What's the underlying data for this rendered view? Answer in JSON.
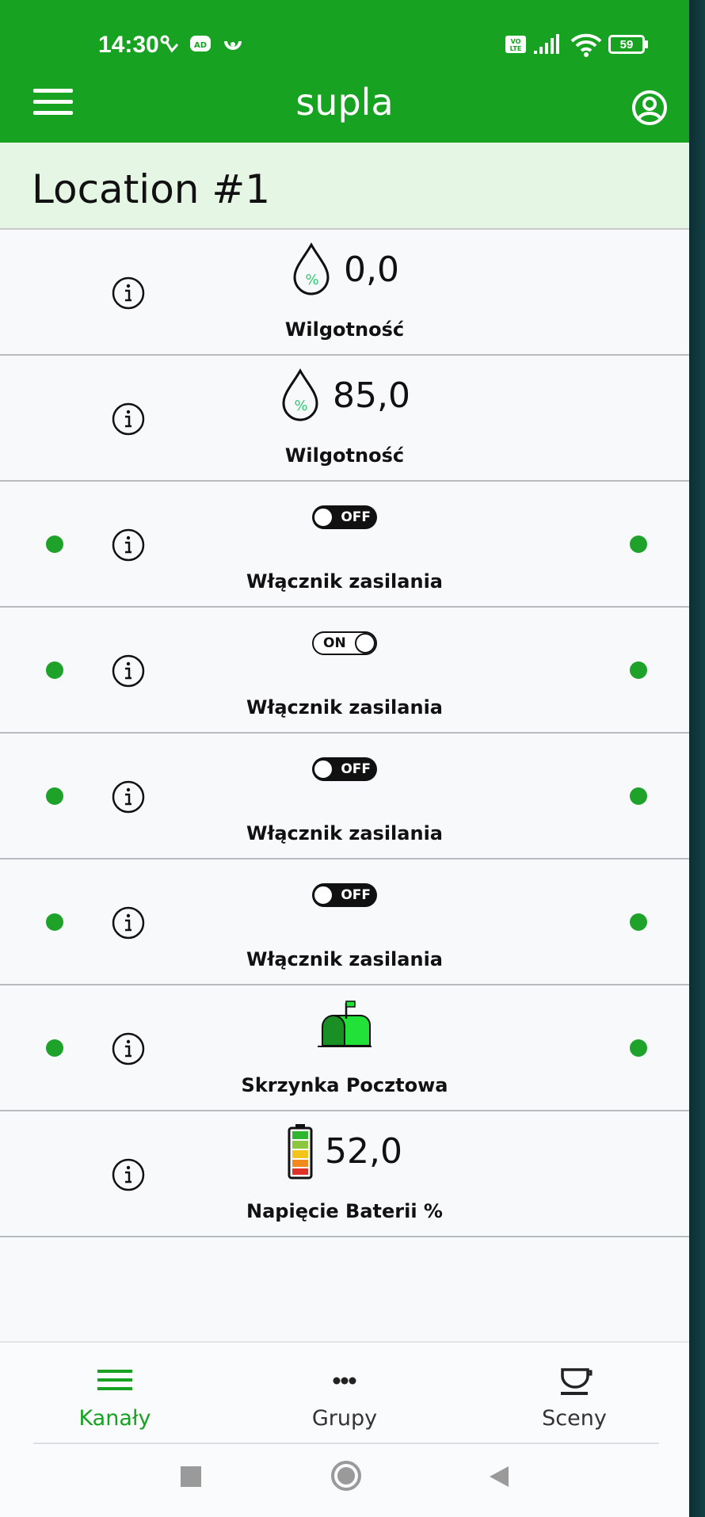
{
  "status_bar": {
    "time": "14:30",
    "battery": "59"
  },
  "app_bar": {
    "title": "supla"
  },
  "location": {
    "label": "Location #1"
  },
  "channels": [
    {
      "type": "humidity",
      "value": "0,0",
      "caption": "Wilgotność",
      "status": false
    },
    {
      "type": "humidity",
      "value": "85,0",
      "caption": "Wilgotność",
      "status": false
    },
    {
      "type": "switch",
      "state": "OFF",
      "caption": "Włącznik zasilania",
      "status": true
    },
    {
      "type": "switch",
      "state": "ON",
      "caption": "Włącznik zasilania",
      "status": true
    },
    {
      "type": "switch",
      "state": "OFF",
      "caption": "Włącznik zasilania",
      "status": true
    },
    {
      "type": "switch",
      "state": "OFF",
      "caption": "Włącznik zasilania",
      "status": true
    },
    {
      "type": "mailbox",
      "caption": "Skrzynka Pocztowa",
      "status": true
    },
    {
      "type": "battery",
      "value": "52,0",
      "caption": "Napięcie Baterii %",
      "status": false
    }
  ],
  "bottom_nav": [
    {
      "label": "Kanały",
      "icon": "list-icon",
      "active": true
    },
    {
      "label": "Grupy",
      "icon": "dots-icon",
      "active": false
    },
    {
      "label": "Sceny",
      "icon": "scene-cup-icon",
      "active": false
    }
  ],
  "colors": {
    "brand_green": "#17a321",
    "status_dot": "#1ea22a",
    "location_bg": "#e6f6e5"
  }
}
